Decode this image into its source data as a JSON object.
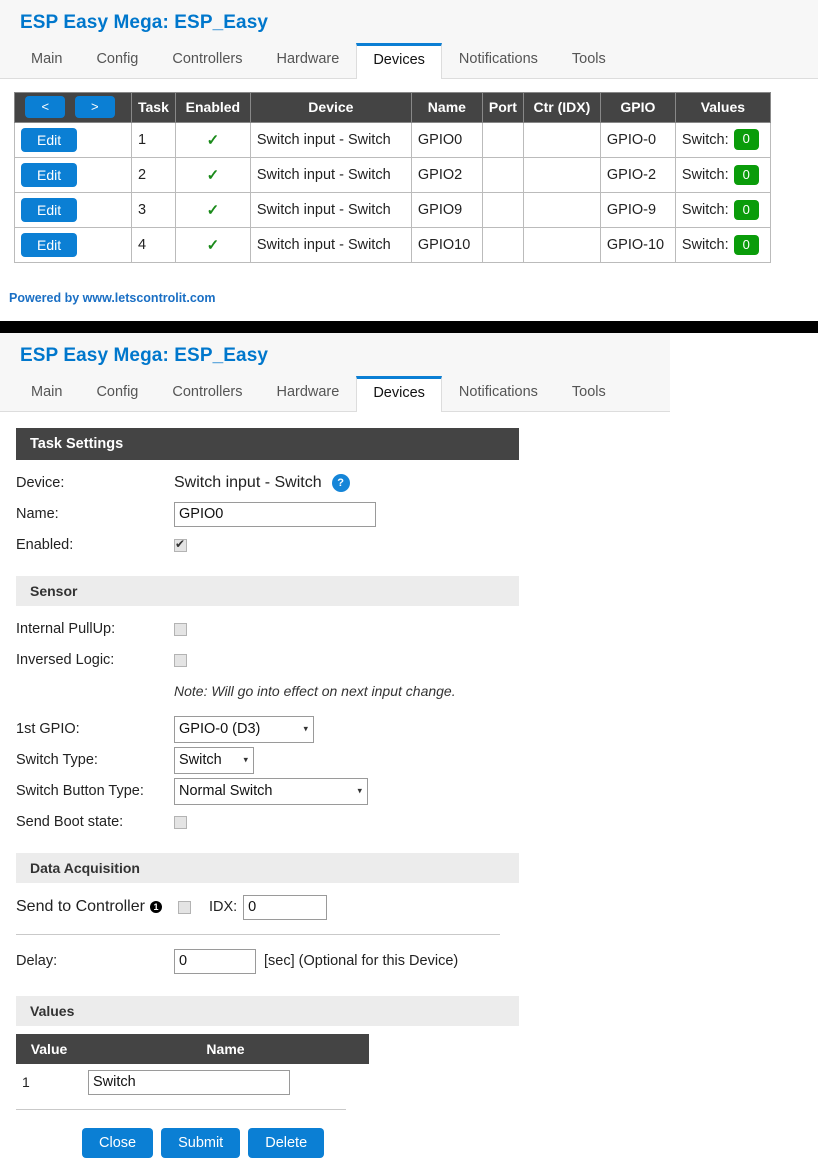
{
  "app": {
    "title": "ESP Easy Mega: ESP_Easy",
    "tabs": [
      {
        "label": "Main",
        "active": false
      },
      {
        "label": "Config",
        "active": false
      },
      {
        "label": "Controllers",
        "active": false
      },
      {
        "label": "Hardware",
        "active": false
      },
      {
        "label": "Devices",
        "active": true
      },
      {
        "label": "Notifications",
        "active": false
      },
      {
        "label": "Tools",
        "active": false
      }
    ],
    "footer": "Powered by www.letscontrolit.com"
  },
  "device_list": {
    "nav": {
      "prev": "<",
      "next": ">"
    },
    "columns": [
      "Task",
      "Enabled",
      "Device",
      "Name",
      "Port",
      "Ctr (IDX)",
      "GPIO",
      "Values"
    ],
    "edit_label": "Edit",
    "enabled_mark": "✓",
    "rows": [
      {
        "task": "1",
        "enabled": "✓",
        "device": "Switch input - Switch",
        "name": "GPIO0",
        "port": "",
        "ctr": "",
        "gpio": "GPIO-0",
        "value_label": "Switch:",
        "value": "0"
      },
      {
        "task": "2",
        "enabled": "✓",
        "device": "Switch input - Switch",
        "name": "GPIO2",
        "port": "",
        "ctr": "",
        "gpio": "GPIO-2",
        "value_label": "Switch:",
        "value": "0"
      },
      {
        "task": "3",
        "enabled": "✓",
        "device": "Switch input - Switch",
        "name": "GPIO9",
        "port": "",
        "ctr": "",
        "gpio": "GPIO-9",
        "value_label": "Switch:",
        "value": "0"
      },
      {
        "task": "4",
        "enabled": "✓",
        "device": "Switch input - Switch",
        "name": "GPIO10",
        "port": "",
        "ctr": "",
        "gpio": "GPIO-10",
        "value_label": "Switch:",
        "value": "0"
      }
    ]
  },
  "task_settings": {
    "section_title": "Task Settings",
    "device_label": "Device:",
    "device_value": "Switch input - Switch",
    "help_glyph": "?",
    "name_label": "Name:",
    "name_value": "GPIO0",
    "enabled_label": "Enabled:",
    "enabled_checked": true
  },
  "sensor": {
    "section_title": "Sensor",
    "internal_pullup_label": "Internal PullUp:",
    "internal_pullup_checked": false,
    "inversed_logic_label": "Inversed Logic:",
    "inversed_logic_checked": false,
    "note": "Note: Will go into effect on next input change.",
    "gpio1_label": "1st GPIO:",
    "gpio1_value": "GPIO-0 (D3)",
    "switch_type_label": "Switch Type:",
    "switch_type_value": "Switch",
    "switch_button_type_label": "Switch Button Type:",
    "switch_button_type_value": "Normal Switch",
    "send_boot_state_label": "Send Boot state:",
    "send_boot_state_checked": false
  },
  "data_acquisition": {
    "section_title": "Data Acquisition",
    "send_to_controller_label": "Send to Controller",
    "controller_index": "1",
    "send_to_controller_checked": false,
    "idx_label": "IDX:",
    "idx_value": "0",
    "delay_label": "Delay:",
    "delay_value": "0",
    "delay_suffix": "[sec] (Optional for this Device)"
  },
  "values": {
    "section_title": "Values",
    "columns": [
      "Value",
      "Name"
    ],
    "rows": [
      {
        "index": "1",
        "name": "Switch"
      }
    ]
  },
  "actions": {
    "close": "Close",
    "submit": "Submit",
    "delete": "Delete"
  },
  "colors": {
    "accent_blue": "#0b7fd4",
    "title_blue": "#0077cc",
    "header_dark": "#444444",
    "badge_green": "#0a9c0a",
    "check_green": "#1a8a1a"
  },
  "icons": {
    "caret_down": "▾"
  }
}
